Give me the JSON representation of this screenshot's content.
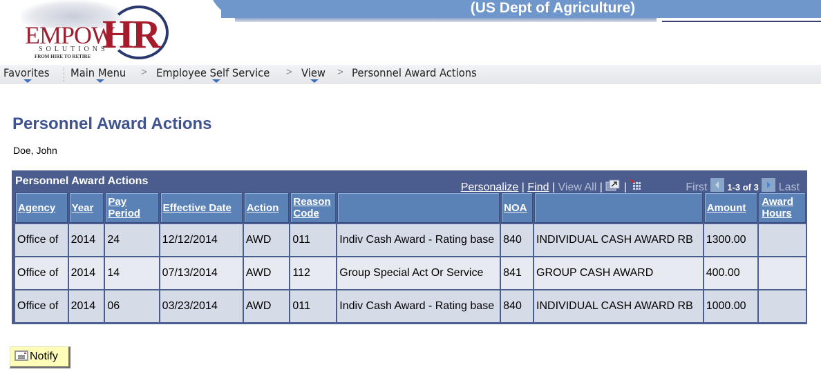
{
  "banner": {
    "title": "(US Dept of Agriculture)",
    "colors": {
      "bar": "#7097cc"
    }
  },
  "logo": {
    "empow": "EMPOW",
    "hr": "HR",
    "solutions": "SOLUTIONS",
    "tagline": "FROM HIRE TO RETIRE"
  },
  "nav": {
    "favorites": "Favorites",
    "main_menu": "Main Menu",
    "ess": "Employee Self Service",
    "view": "View",
    "current": "Personnel Award Actions",
    "separator": ">"
  },
  "page": {
    "title": "Personnel Award Actions",
    "employee": "Doe, John"
  },
  "grid": {
    "title": "Personnel Award Actions",
    "tools": {
      "personalize": "Personalize",
      "find": "Find",
      "view_all": "View All",
      "sep": "|",
      "first": "First",
      "range": "1-3 of 3",
      "last": "Last"
    },
    "columns": {
      "agency": "Agency",
      "year": "Year",
      "pay_period_1": "Pay",
      "pay_period_2": "Period",
      "effective_date": "Effective Date",
      "action": "Action",
      "reason_code_1": "Reason",
      "reason_code_2": "Code",
      "reason_desc": "",
      "noa": "NOA",
      "noa_desc": "",
      "amount": "Amount",
      "award_hours_1": "Award",
      "award_hours_2": "Hours"
    },
    "rows": [
      {
        "agency": "Office of",
        "year": "2014",
        "pay_period": "24",
        "effective_date": "12/12/2014",
        "action": "AWD",
        "reason_code": "011",
        "reason_desc": "Indiv Cash Award - Rating base",
        "noa": "840",
        "noa_desc": "INDIVIDUAL CASH AWARD RB",
        "amount": "1300.00",
        "award_hours": ""
      },
      {
        "agency": "Office of",
        "year": "2014",
        "pay_period": "14",
        "effective_date": "07/13/2014",
        "action": "AWD",
        "reason_code": "112",
        "reason_desc": "Group Special Act Or Service",
        "noa": "841",
        "noa_desc": "GROUP CASH AWARD",
        "amount": "400.00",
        "award_hours": ""
      },
      {
        "agency": "Office of",
        "year": "2014",
        "pay_period": "06",
        "effective_date": "03/23/2014",
        "action": "AWD",
        "reason_code": "011",
        "reason_desc": "Indiv Cash Award - Rating base",
        "noa": "840",
        "noa_desc": "INDIVIDUAL CASH AWARD RB",
        "amount": "1000.00",
        "award_hours": ""
      }
    ]
  },
  "notify": {
    "label": "Notify"
  }
}
